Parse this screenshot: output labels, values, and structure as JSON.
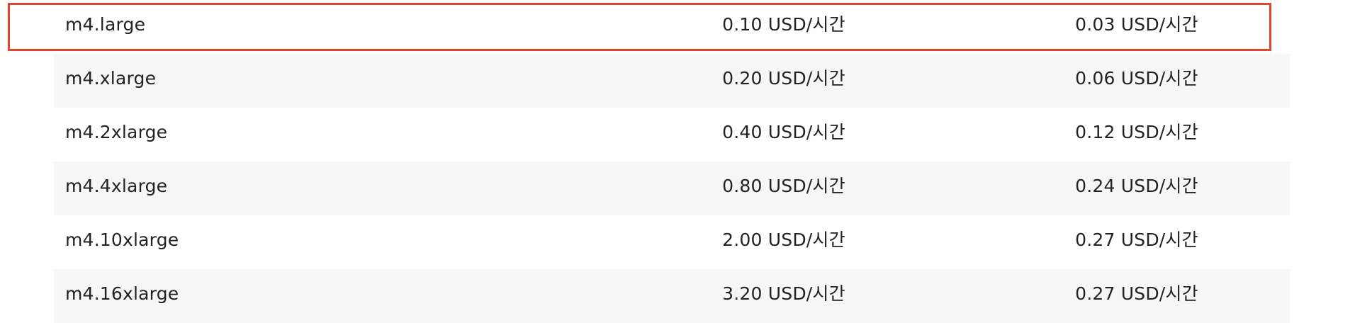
{
  "rows": [
    {
      "name": "m4.large",
      "on_demand": "0.10 USD/시간",
      "spot": "0.03 USD/시간",
      "highlighted": true
    },
    {
      "name": "m4.xlarge",
      "on_demand": "0.20 USD/시간",
      "spot": "0.06 USD/시간"
    },
    {
      "name": "m4.2xlarge",
      "on_demand": "0.40 USD/시간",
      "spot": "0.12 USD/시간"
    },
    {
      "name": "m4.4xlarge",
      "on_demand": "0.80 USD/시간",
      "spot": "0.24 USD/시간"
    },
    {
      "name": "m4.10xlarge",
      "on_demand": "2.00 USD/시간",
      "spot": "0.27 USD/시간"
    },
    {
      "name": "m4.16xlarge",
      "on_demand": "3.20 USD/시간",
      "spot": "0.27 USD/시간"
    }
  ],
  "colors": {
    "highlight_border": "#e0452f",
    "alt_row_bg": "#f6f6f6",
    "text": "#222222"
  }
}
